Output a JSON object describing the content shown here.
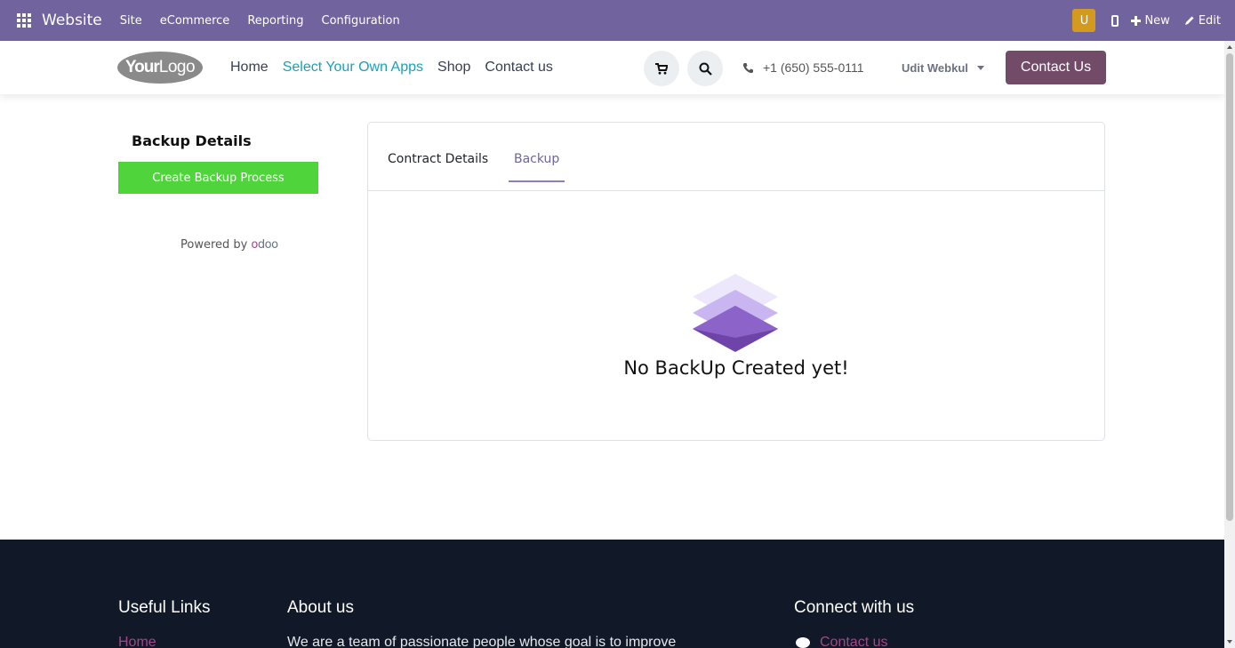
{
  "adminbar": {
    "brand": "Website",
    "menu": [
      "Site",
      "eCommerce",
      "Reporting",
      "Configuration"
    ],
    "avatar_letter": "U",
    "new_label": "New",
    "edit_label": "Edit",
    "color": "#71639e"
  },
  "header": {
    "logo_bold": "Your",
    "logo_light": "Logo",
    "nav": [
      "Home",
      "Select Your Own Apps",
      "Shop",
      "Contact us"
    ],
    "phone": "+1 (650) 555-0111",
    "user": "Udit Webkul",
    "contact_button": "Contact Us",
    "active_nav_color": "#17a2b8",
    "contact_color": "#714b67"
  },
  "sidebar": {
    "title": "Backup Details",
    "create_button": "Create Backup Process",
    "powered_by": "Powered by",
    "odoo_letters": [
      "o",
      "d",
      "o",
      "o"
    ],
    "button_color": "#4fd43c"
  },
  "card": {
    "tabs": [
      "Contract Details",
      "Backup"
    ],
    "active_tab": "Backup",
    "empty_message": "No BackUp Created yet!"
  },
  "footer": {
    "useful_links": "Useful Links",
    "about_us": "About us",
    "connect": "Connect with us",
    "home_link": "Home",
    "about_text": "We are a team of passionate people whose goal is to improve",
    "contact_link": "Contact us"
  }
}
